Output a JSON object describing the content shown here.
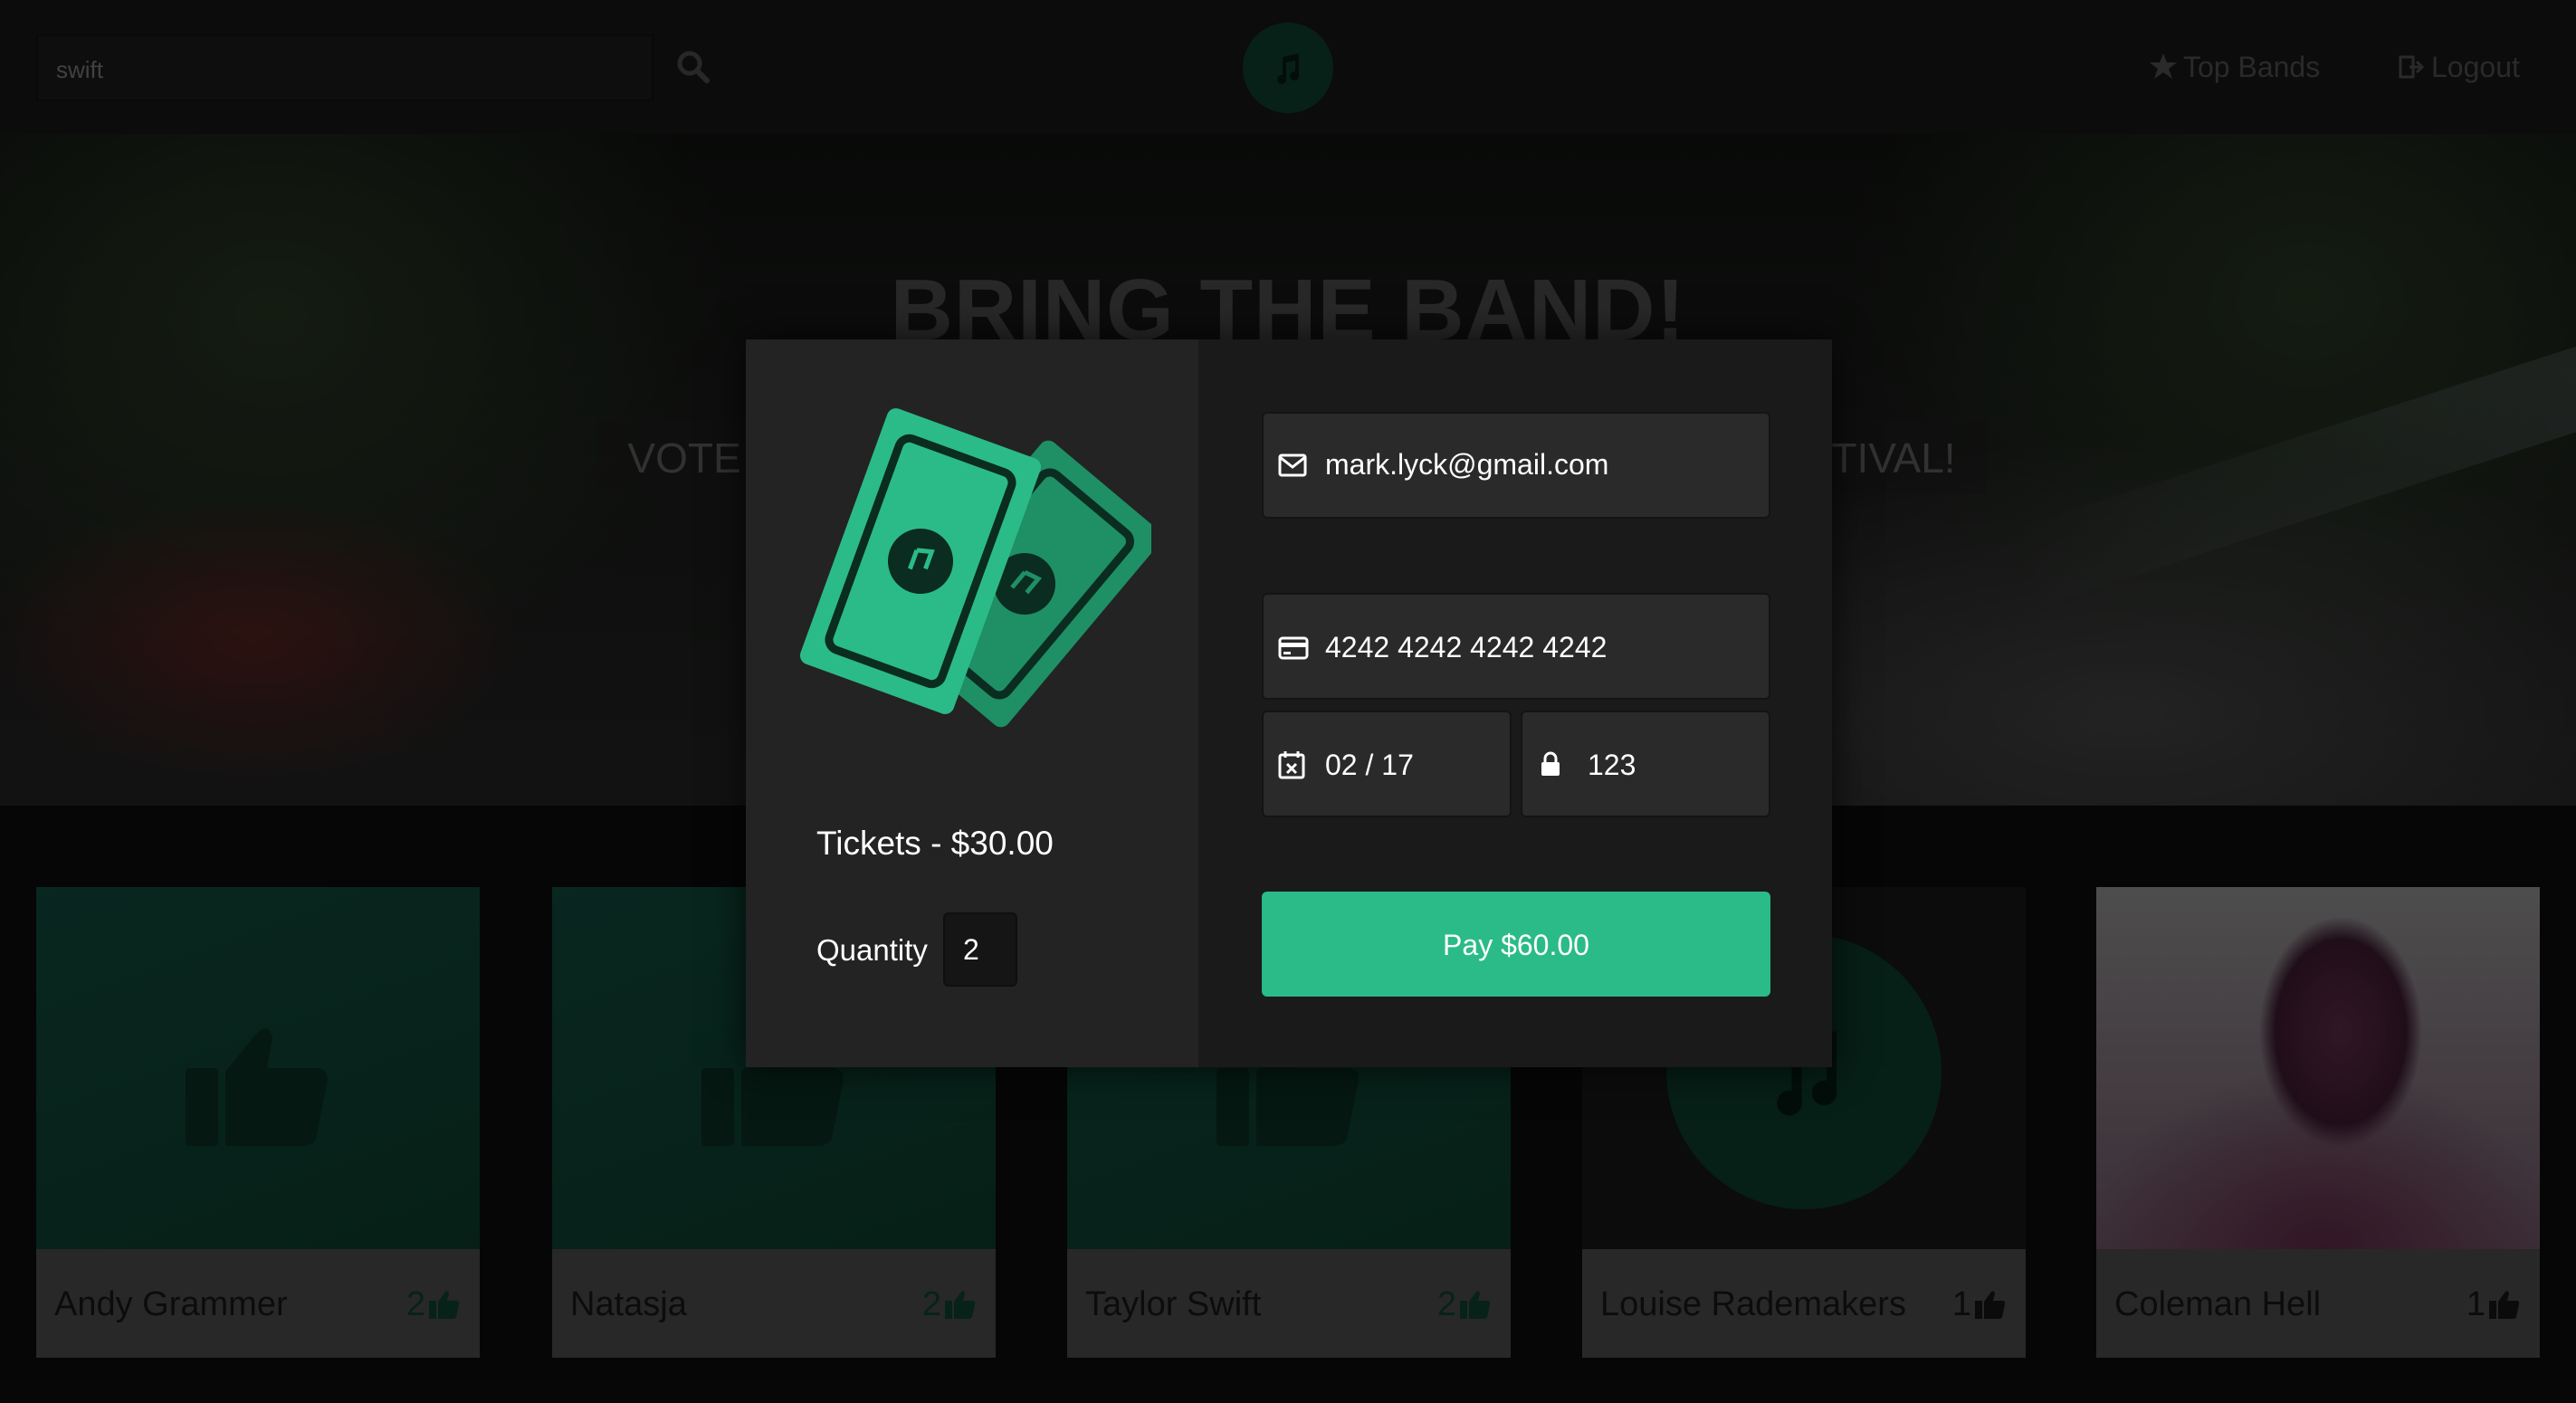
{
  "search": {
    "value": "swift"
  },
  "nav": {
    "top_bands": "Top Bands",
    "logout": "Logout"
  },
  "hero": {
    "title": "BRING THE BAND!",
    "subtitle_left": "VOTE",
    "subtitle_right": "TIVAL!"
  },
  "bands": [
    {
      "name": "Andy Grammer",
      "votes": "2"
    },
    {
      "name": "Natasja",
      "votes": "2"
    },
    {
      "name": "Taylor Swift",
      "votes": "2"
    },
    {
      "name": "Louise Rademakers",
      "votes": "1"
    },
    {
      "name": "Coleman Hell",
      "votes": "1"
    }
  ],
  "checkout": {
    "tickets_label": "Tickets - $30.00",
    "quantity_label": "Quantity",
    "quantity_value": "2",
    "email": "mark.lyck@gmail.com",
    "card_number": "4242 4242 4242 4242",
    "expiry": "02 / 17",
    "cvc": "123",
    "pay_label": "Pay $60.00"
  },
  "colors": {
    "accent": "#2bbb88",
    "accent_dark": "#0e3e2e",
    "modal_left": "#232323",
    "modal_right": "#1a1a1a"
  },
  "icons": {
    "search": "search-icon",
    "logo": "music-note-icon",
    "top_bands": "star-icon",
    "logout": "logout-icon",
    "vote": "thumbs-up-icon",
    "email": "envelope-icon",
    "card": "credit-card-icon",
    "expiry": "calendar-icon",
    "cvc": "lock-icon"
  }
}
